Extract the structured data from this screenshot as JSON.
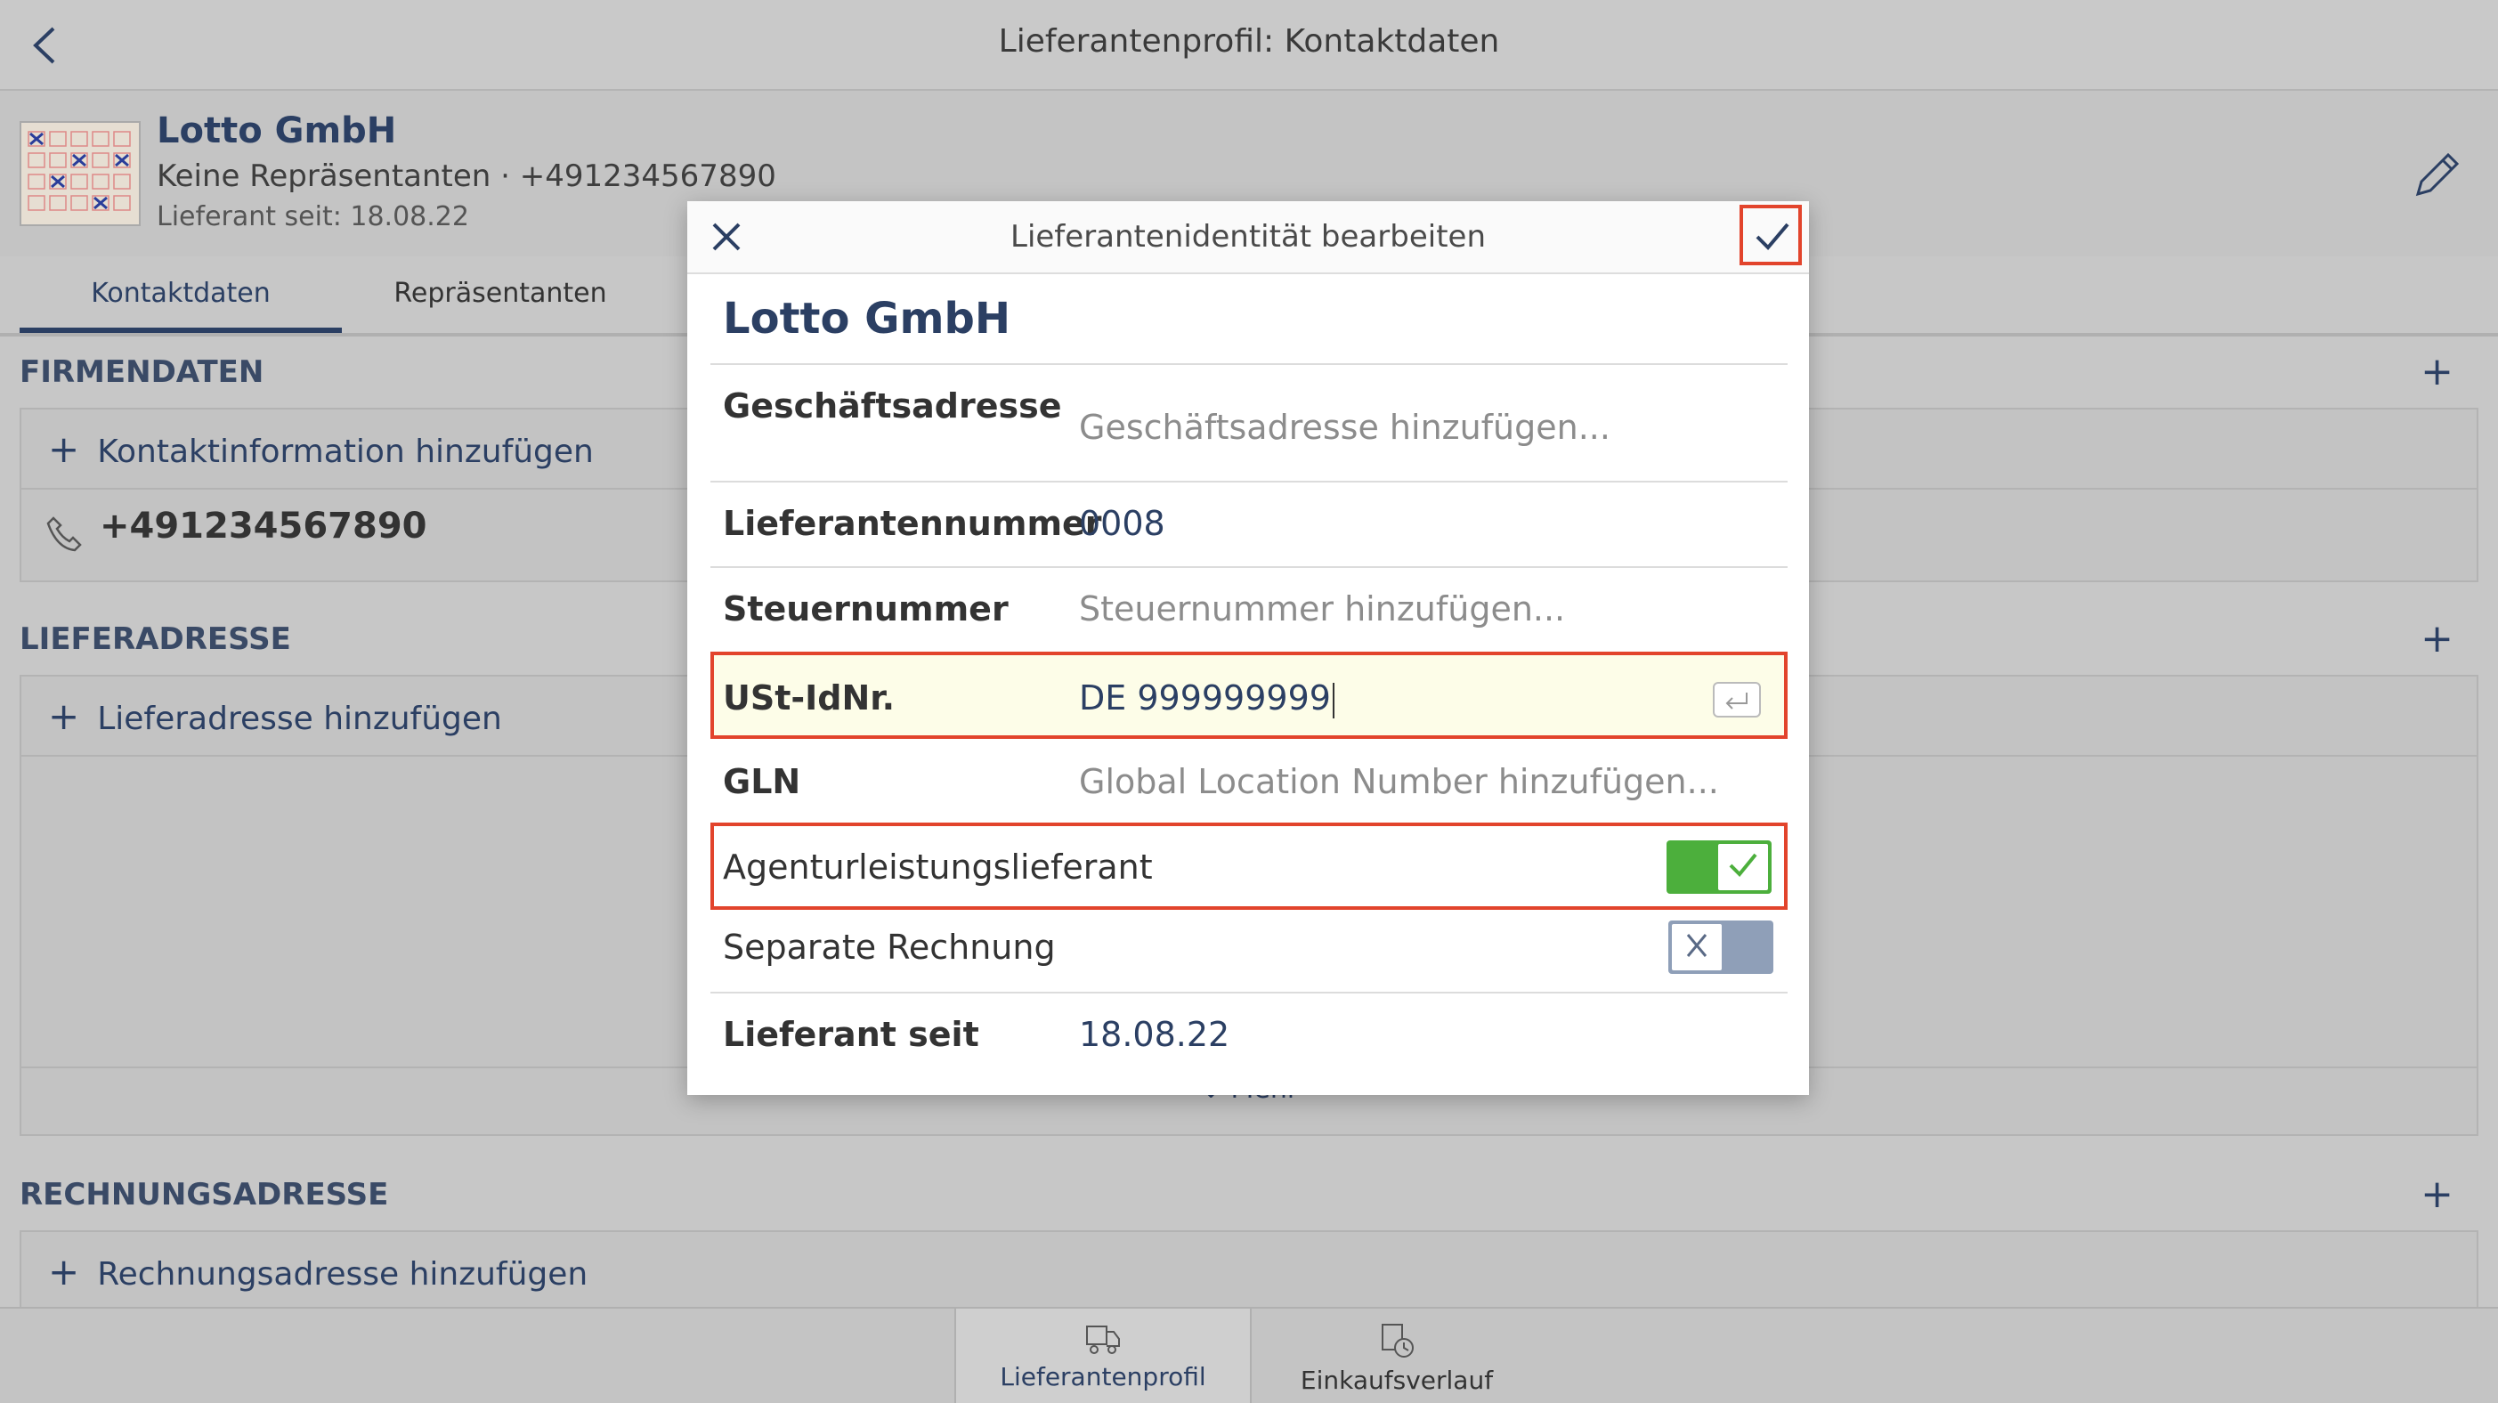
{
  "topbar": {
    "title": "Lieferantenprofil: Kontaktdaten"
  },
  "header": {
    "company": "Lotto GmbH",
    "subline": "Keine Repräsentanten · +491234567890",
    "since": "Lieferant seit: 18.08.22"
  },
  "tabs": [
    {
      "label": "Kontaktdaten"
    },
    {
      "label": "Repräsentanten"
    }
  ],
  "sections": {
    "firmendaten": {
      "title": "FIRMENDATEN",
      "add": "Kontaktinformation hinzufügen",
      "phone": "+491234567890"
    },
    "lieferadresse": {
      "title": "LIEFERADRESSE",
      "add": "Lieferadresse hinzufügen",
      "more": "Mehr"
    },
    "rechnungsadresse": {
      "title": "RECHNUNGSADRESSE",
      "add": "Rechnungsadresse hinzufügen"
    }
  },
  "bottom_tabs": [
    {
      "label": "Lieferantenprofil"
    },
    {
      "label": "Einkaufsverlauf"
    }
  ],
  "modal": {
    "title": "Lieferantenidentität bearbeiten",
    "company": "Lotto GmbH",
    "fields": {
      "address": {
        "label": "Geschäftsadresse",
        "placeholder": "Geschäftsadresse hinzufügen..."
      },
      "supplier_no": {
        "label": "Lieferantennummer",
        "value": "0008"
      },
      "tax_no": {
        "label": "Steuernummer",
        "placeholder": "Steuernummer hinzufügen..."
      },
      "vat_id": {
        "label": "USt-IdNr.",
        "value": "DE 999999999"
      },
      "gln": {
        "label": "GLN",
        "placeholder": "Global Location Number hinzufügen..."
      },
      "agency": {
        "label": "Agenturleistungslieferant",
        "checked": true
      },
      "separate_invoice": {
        "label": "Separate Rechnung",
        "checked": false
      },
      "since": {
        "label": "Lieferant seit",
        "value": "18.08.22"
      }
    }
  },
  "colors": {
    "accent": "#2b3f63",
    "highlight": "#e2442c",
    "toggle_on": "#4caf3c",
    "toggle_off": "#8f9fb8"
  }
}
